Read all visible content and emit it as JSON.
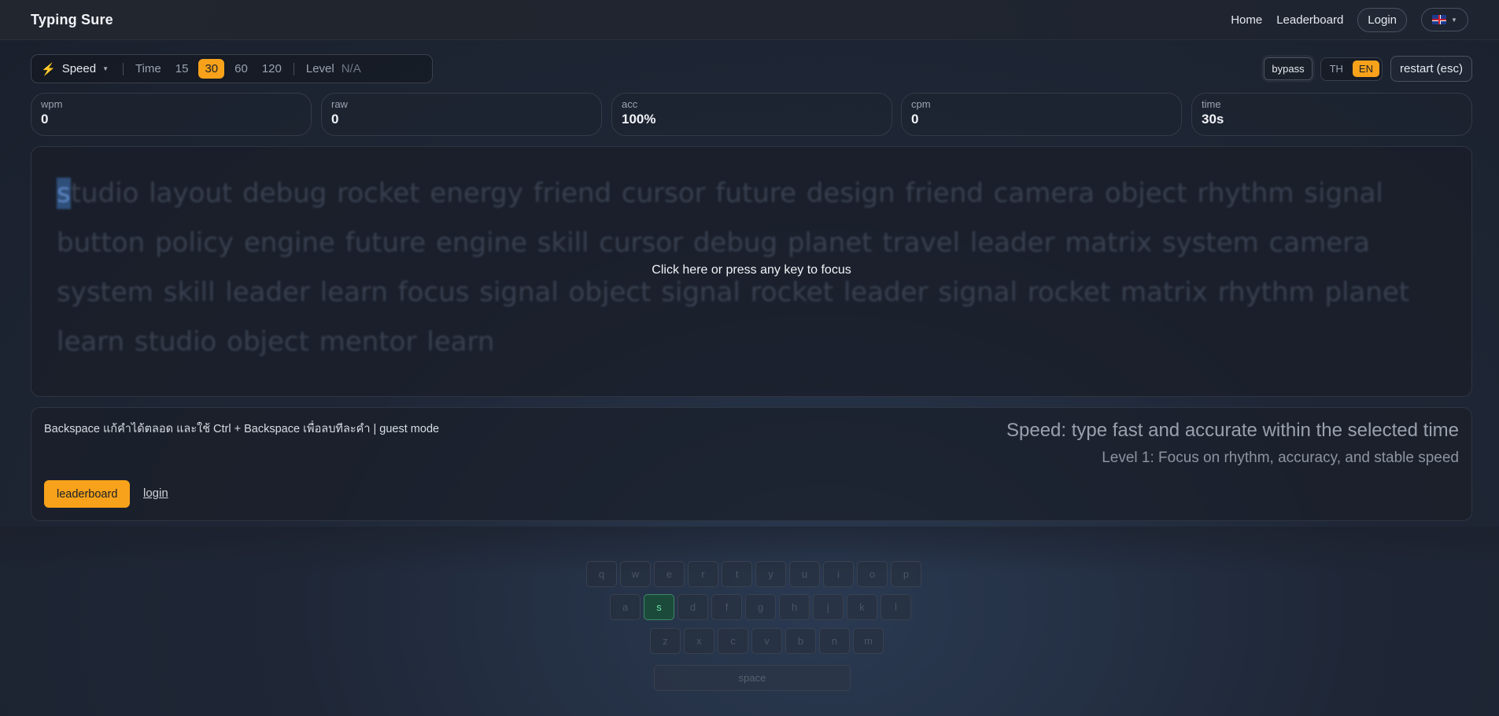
{
  "header": {
    "brand": "Typing Sure",
    "nav": [
      "Home",
      "Leaderboard"
    ],
    "login_label": "Login",
    "language_icon": "uk-flag-icon"
  },
  "modebar": {
    "mode_label": "Speed",
    "time_label": "Time",
    "time_options": [
      "15",
      "30",
      "60",
      "120"
    ],
    "time_selected": "30",
    "level_label": "Level",
    "level_value": "N/A"
  },
  "tools": {
    "bypass_label": "bypass",
    "lang_options": [
      "TH",
      "EN"
    ],
    "lang_selected": "EN",
    "restart_label": "restart (esc)"
  },
  "stats": [
    {
      "label": "wpm",
      "value": "0"
    },
    {
      "label": "raw",
      "value": "0"
    },
    {
      "label": "acc",
      "value": "100%"
    },
    {
      "label": "cpm",
      "value": "0"
    },
    {
      "label": "time",
      "value": "30s"
    }
  ],
  "typing": {
    "first_char": "s",
    "text_rest": "tudio layout debug rocket energy friend cursor future design friend camera object rhythm signal button policy engine future engine skill cursor debug planet travel leader matrix system camera system skill leader learn focus signal object signal rocket leader signal rocket matrix rhythm planet learn studio object mentor learn",
    "focus_message": "Click here or press any key to focus"
  },
  "info": {
    "hint": "Backspace แก้คำได้ตลอด และใช้ Ctrl + Backspace เพื่อลบทีละคำ | guest mode",
    "mode_title": "Speed: type fast and accurate within the selected time",
    "mode_subtitle": "Level 1: Focus on rhythm, accuracy, and stable speed",
    "leaderboard_button": "leaderboard",
    "login_link": "login"
  },
  "keyboard": {
    "row1": [
      "q",
      "w",
      "e",
      "r",
      "t",
      "y",
      "u",
      "i",
      "o",
      "p"
    ],
    "row2": [
      "a",
      "s",
      "d",
      "f",
      "g",
      "h",
      "j",
      "k",
      "l"
    ],
    "row3": [
      "z",
      "x",
      "c",
      "v",
      "b",
      "n",
      "m"
    ],
    "active_key": "s",
    "space_label": "space",
    "active_color": "#3a8a68"
  },
  "colors": {
    "accent": "#f7a21a"
  }
}
